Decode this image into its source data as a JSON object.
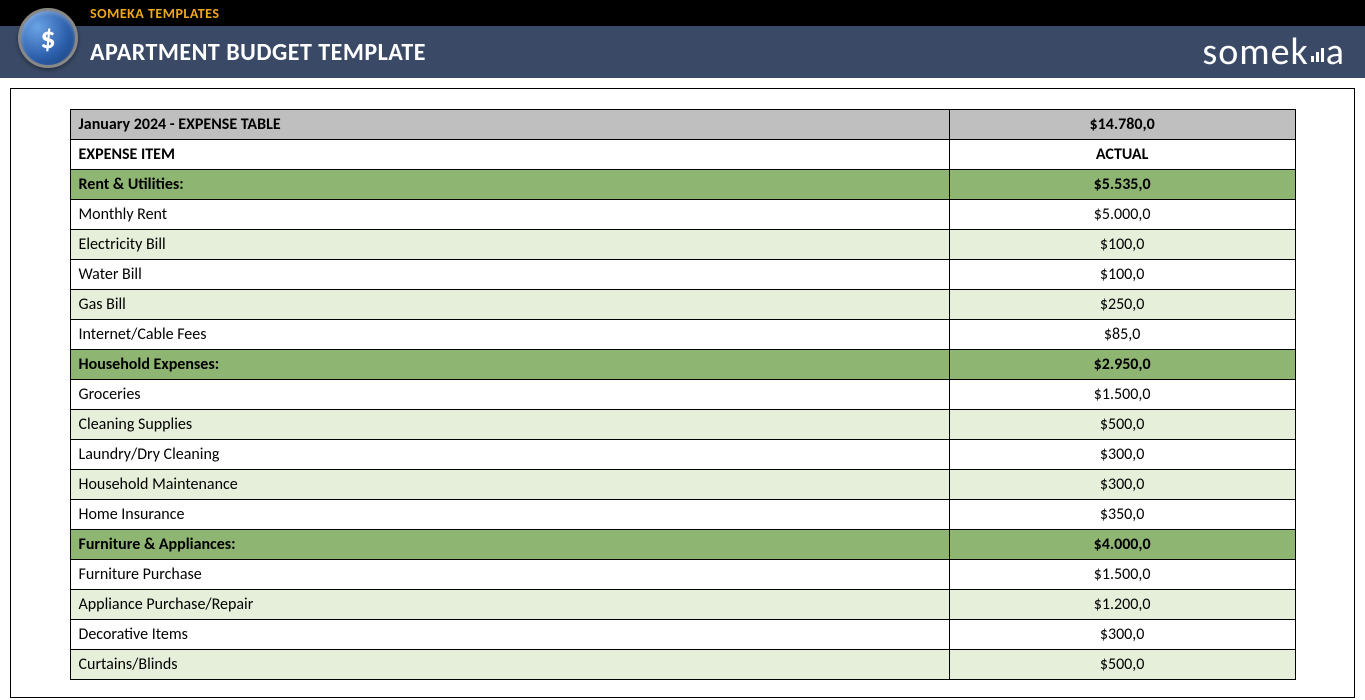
{
  "header": {
    "brand": "SOMEKA TEMPLATES",
    "title": "APARTMENT BUDGET TEMPLATE",
    "logo_text": "someka"
  },
  "table": {
    "title": "January 2024 - EXPENSE TABLE",
    "total": "$14.780,0",
    "col_item": "EXPENSE ITEM",
    "col_actual": "ACTUAL",
    "sections": [
      {
        "name": "Rent & Utilities:",
        "subtotal": "$5.535,0",
        "rows": [
          {
            "item": "Monthly Rent",
            "actual": "$5.000,0"
          },
          {
            "item": "Electricity Bill",
            "actual": "$100,0"
          },
          {
            "item": "Water Bill",
            "actual": "$100,0"
          },
          {
            "item": "Gas Bill",
            "actual": "$250,0"
          },
          {
            "item": "Internet/Cable Fees",
            "actual": "$85,0"
          }
        ]
      },
      {
        "name": "Household Expenses:",
        "subtotal": "$2.950,0",
        "rows": [
          {
            "item": "Groceries",
            "actual": "$1.500,0"
          },
          {
            "item": "Cleaning Supplies",
            "actual": "$500,0"
          },
          {
            "item": "Laundry/Dry Cleaning",
            "actual": "$300,0"
          },
          {
            "item": "Household Maintenance",
            "actual": "$300,0"
          },
          {
            "item": "Home Insurance",
            "actual": "$350,0"
          }
        ]
      },
      {
        "name": "Furniture & Appliances:",
        "subtotal": "$4.000,0",
        "rows": [
          {
            "item": "Furniture Purchase",
            "actual": "$1.500,0"
          },
          {
            "item": "Appliance Purchase/Repair",
            "actual": "$1.200,0"
          },
          {
            "item": "Decorative Items",
            "actual": "$300,0"
          },
          {
            "item": "Curtains/Blinds",
            "actual": "$500,0"
          }
        ]
      }
    ]
  }
}
